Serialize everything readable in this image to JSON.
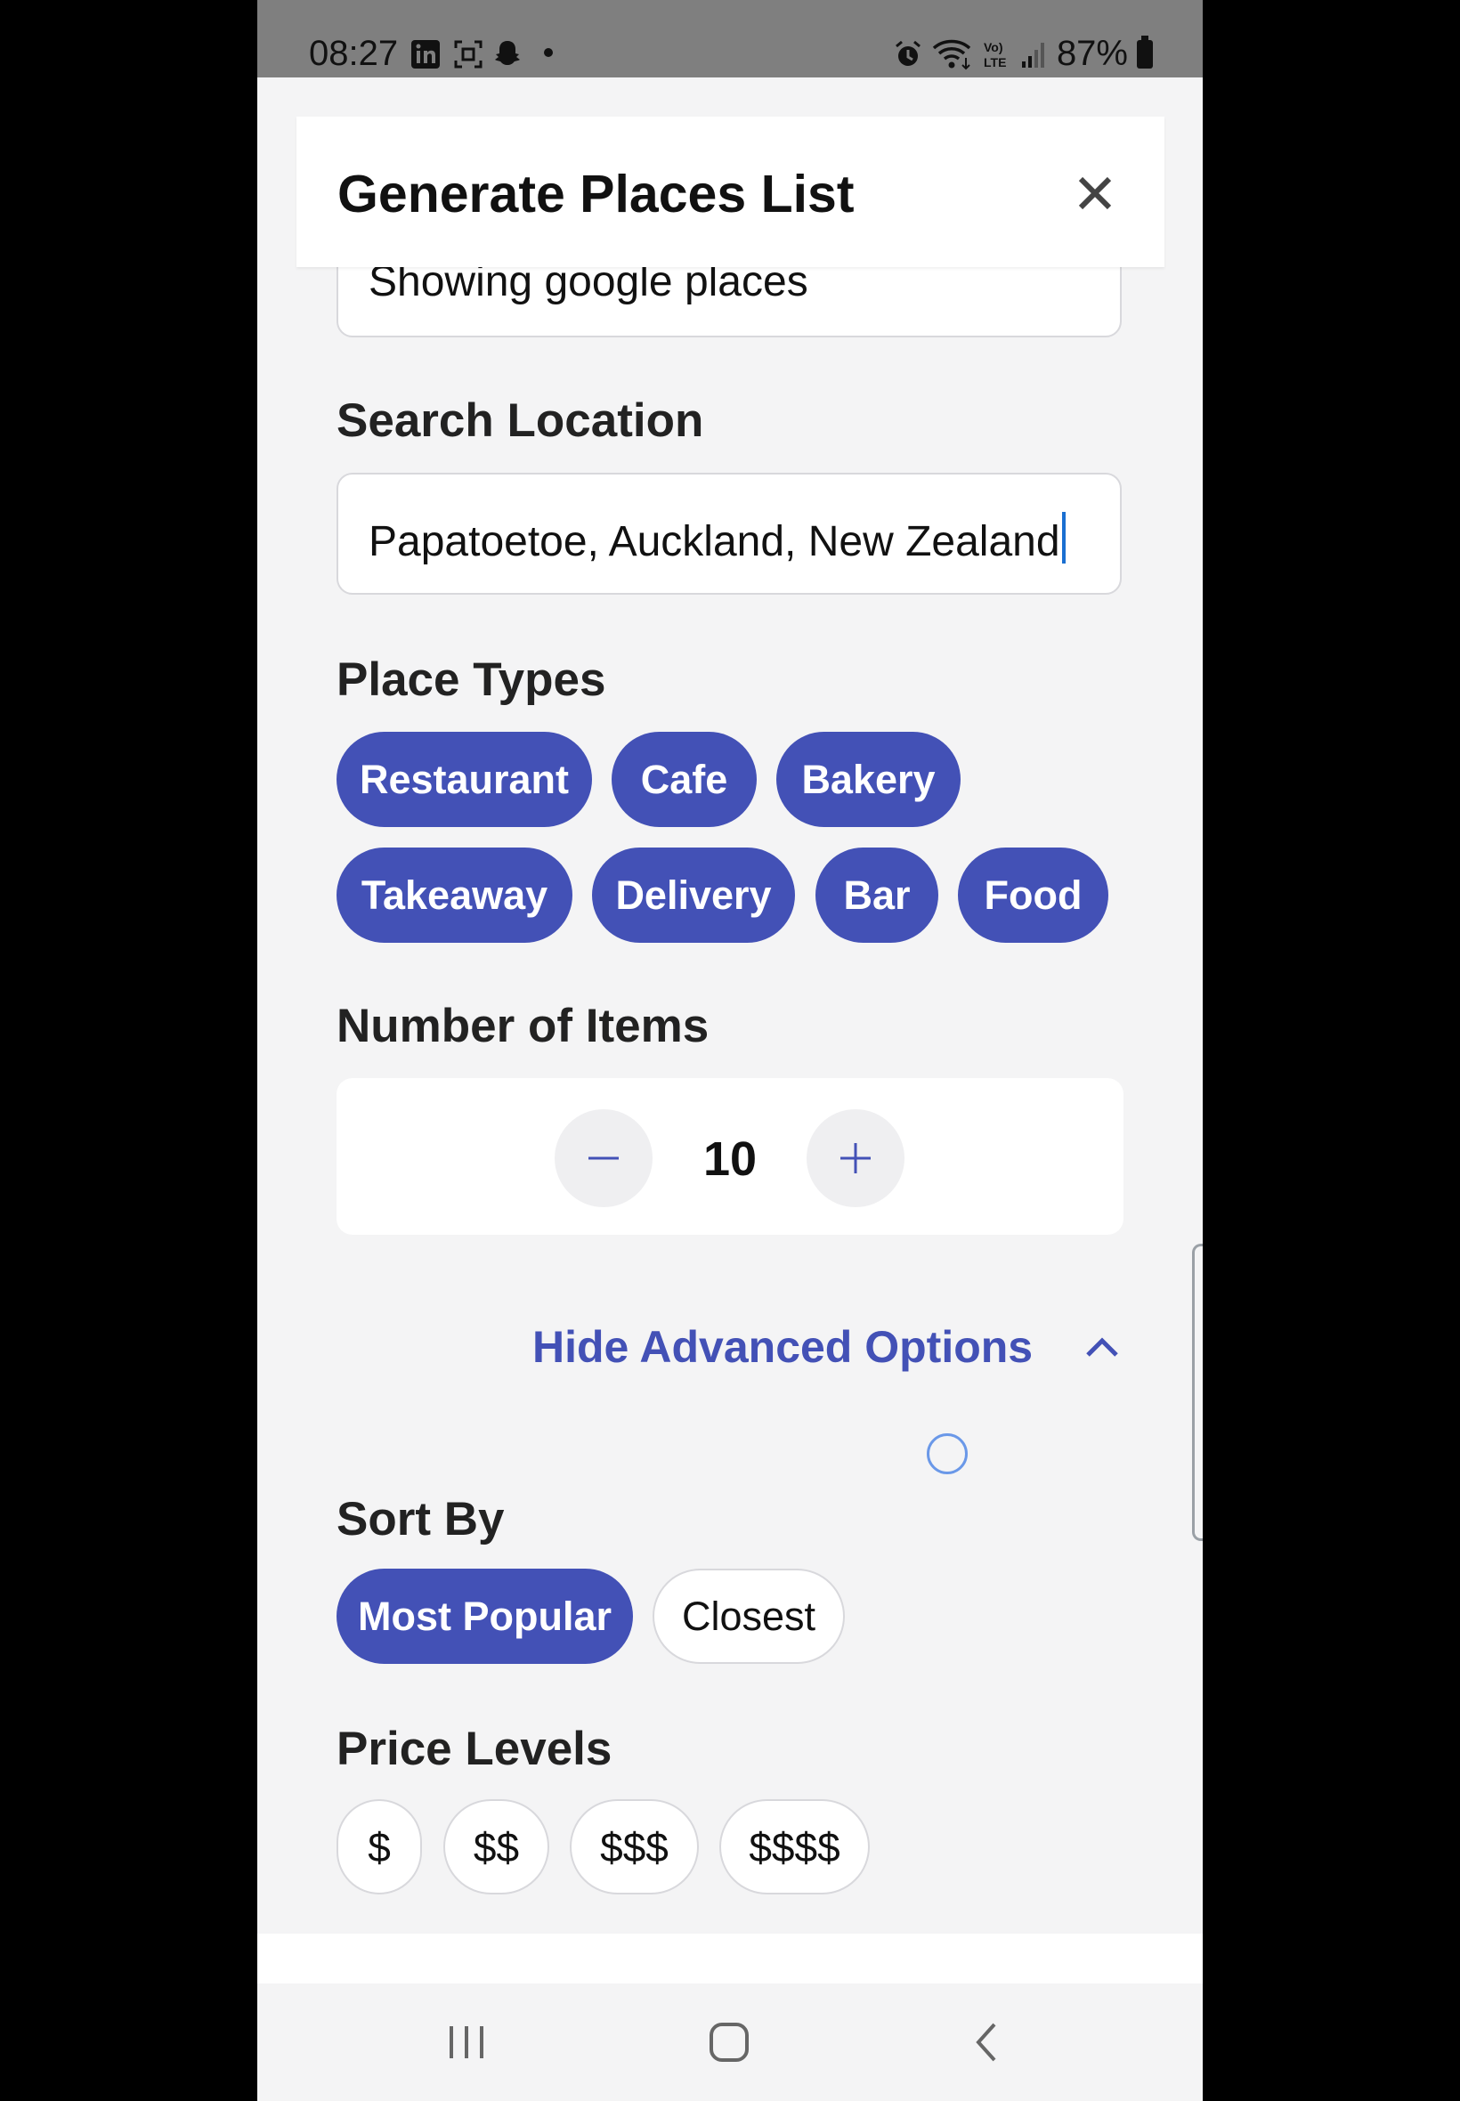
{
  "status_bar": {
    "time": "08:27",
    "battery": "87%"
  },
  "header": {
    "title": "Generate Places List"
  },
  "previous_field": {
    "value": "Showing google places"
  },
  "search_location": {
    "label": "Search Location",
    "value": "Papatoetoe, Auckland, New Zealand"
  },
  "place_types": {
    "label": "Place Types",
    "items": [
      {
        "label": "Restaurant",
        "selected": true
      },
      {
        "label": "Cafe",
        "selected": true
      },
      {
        "label": "Bakery",
        "selected": true
      },
      {
        "label": "Takeaway",
        "selected": true
      },
      {
        "label": "Delivery",
        "selected": true
      },
      {
        "label": "Bar",
        "selected": true
      },
      {
        "label": "Food",
        "selected": true
      }
    ]
  },
  "number_of_items": {
    "label": "Number of Items",
    "value": "10"
  },
  "advanced_toggle": {
    "label": "Hide Advanced Options"
  },
  "sort_by": {
    "label": "Sort By",
    "options": [
      {
        "label": "Most Popular",
        "selected": true
      },
      {
        "label": "Closest",
        "selected": false
      }
    ]
  },
  "price_levels": {
    "label": "Price Levels",
    "options": [
      {
        "label": "$",
        "selected": false
      },
      {
        "label": "$$",
        "selected": false
      },
      {
        "label": "$$$",
        "selected": false
      },
      {
        "label": "$$$$",
        "selected": false
      }
    ]
  },
  "colors": {
    "accent": "#4351b6",
    "background": "#f4f4f5",
    "status_bar": "#7f7f7f"
  },
  "icons": [
    "linkedin-icon",
    "screenshot-icon",
    "snapchat-icon",
    "alarm-icon",
    "wifi-icon",
    "volte-icon",
    "signal-icon",
    "battery-icon",
    "close-icon",
    "minus-icon",
    "plus-icon",
    "chevron-up-icon",
    "recents-icon",
    "home-icon",
    "back-icon"
  ]
}
